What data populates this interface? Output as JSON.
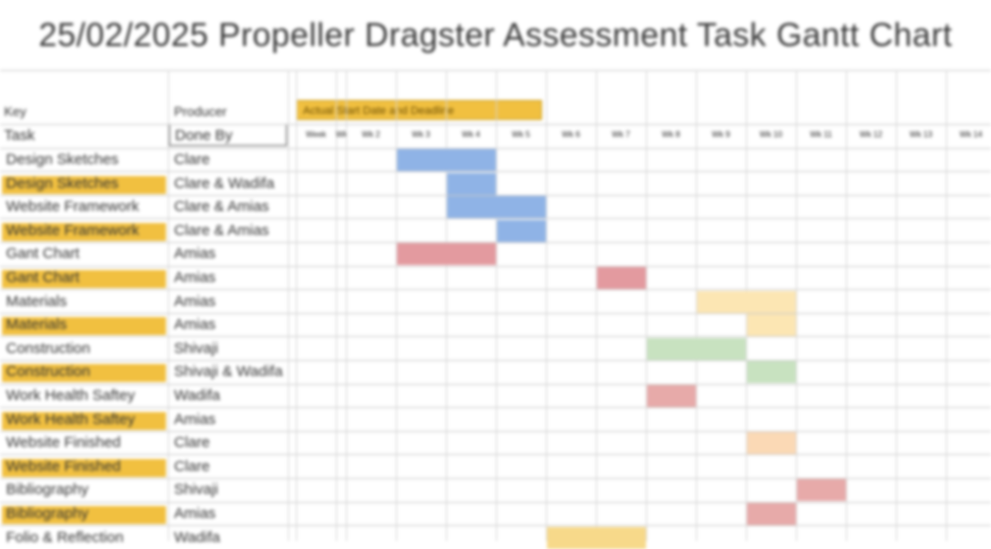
{
  "title": "25/02/2025 Propeller Dragster Assessment Task Gantt Chart",
  "legend": "Actual Start Date and Deadline",
  "headers": {
    "key_label": "Key",
    "task_label": "Task",
    "producer_label": "Producer",
    "done_by_label": "Done By",
    "dates": [
      "Week",
      "Wk 1",
      "Wk 2",
      "Wk 3",
      "Wk 4",
      "Wk 5",
      "Wk 6",
      "Wk 7",
      "Wk 8",
      "Wk 9",
      "Wk 10",
      "Wk 11",
      "Wk 12",
      "Wk 13",
      "Wk 14"
    ]
  },
  "rows": [
    {
      "task": "Design Sketches",
      "who": "Clare",
      "highlight": false
    },
    {
      "task": "Design Sketches",
      "who": "Clare & Wadifa",
      "highlight": true
    },
    {
      "task": "Website Framework",
      "who": "Clare & Amias",
      "highlight": false
    },
    {
      "task": "Website Framework",
      "who": "Clare & Amias",
      "highlight": true
    },
    {
      "task": "Gant Chart",
      "who": "Amias",
      "highlight": false
    },
    {
      "task": "Gant Chart",
      "who": "Amias",
      "highlight": true
    },
    {
      "task": "Materials",
      "who": "Amias",
      "highlight": false
    },
    {
      "task": "Materials",
      "who": "Amias",
      "highlight": true
    },
    {
      "task": "Construction",
      "who": "Shivaji",
      "highlight": false
    },
    {
      "task": "Construction",
      "who": "Shivaji & Wadifa",
      "highlight": true
    },
    {
      "task": "Work Health Saftey",
      "who": "Wadifa",
      "highlight": false
    },
    {
      "task": "Work Health Saftey",
      "who": "Amias",
      "highlight": true
    },
    {
      "task": "Website Finished",
      "who": "Clare",
      "highlight": false
    },
    {
      "task": "Website Finished",
      "who": "Clare",
      "highlight": true
    },
    {
      "task": "Bibliography",
      "who": "Shivaji",
      "highlight": false
    },
    {
      "task": "Bibliography",
      "who": "Amias",
      "highlight": true
    },
    {
      "task": "Folio & Reflection",
      "who": "Wadifa",
      "highlight": false
    }
  ],
  "bars": [
    {
      "row": 0,
      "start": 3,
      "span": 2,
      "color": "#8fb3e6"
    },
    {
      "row": 1,
      "start": 4,
      "span": 1,
      "color": "#8fb3e6"
    },
    {
      "row": 2,
      "start": 4,
      "span": 2,
      "color": "#8fb3e6"
    },
    {
      "row": 3,
      "start": 5,
      "span": 1,
      "color": "#8fb3e6"
    },
    {
      "row": 4,
      "start": 3,
      "span": 2,
      "color": "#e39a9f"
    },
    {
      "row": 5,
      "start": 7,
      "span": 1,
      "color": "#e39a9f"
    },
    {
      "row": 6,
      "start": 9,
      "span": 2,
      "color": "#fce6b3"
    },
    {
      "row": 7,
      "start": 10,
      "span": 1,
      "color": "#fce6b3"
    },
    {
      "row": 8,
      "start": 8,
      "span": 2,
      "color": "#c8e2c0"
    },
    {
      "row": 9,
      "start": 10,
      "span": 1,
      "color": "#c8e2c0"
    },
    {
      "row": 10,
      "start": 8,
      "span": 1,
      "color": "#e7aaa9"
    },
    {
      "row": 12,
      "start": 10,
      "span": 1,
      "color": "#fbd9b5"
    },
    {
      "row": 14,
      "start": 11,
      "span": 1,
      "color": "#e7aaa9"
    },
    {
      "row": 15,
      "start": 10,
      "span": 1,
      "color": "#e7aaa9"
    },
    {
      "row": 16,
      "start": 6,
      "span": 2,
      "color": "#f7d98a"
    }
  ]
}
